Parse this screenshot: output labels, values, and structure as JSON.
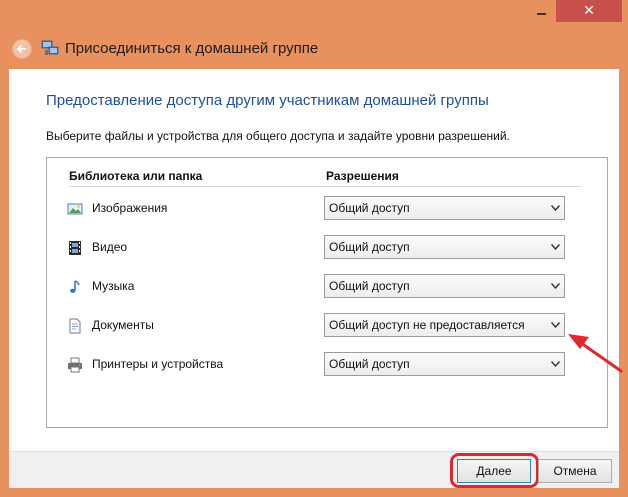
{
  "window": {
    "title": "Присоединиться к домашней группе",
    "close_glyph": "✕"
  },
  "content": {
    "heading": "Предоставление доступа другим участникам домашней группы",
    "instruction": "Выберите файлы и устройства для общего доступа и задайте уровни разрешений."
  },
  "table": {
    "col_library": "Библиотека или папка",
    "col_permissions": "Разрешения",
    "rows": [
      {
        "icon": "pictures-icon",
        "label": "Изображения",
        "permission": "Общий доступ"
      },
      {
        "icon": "video-icon",
        "label": "Видео",
        "permission": "Общий доступ"
      },
      {
        "icon": "music-icon",
        "label": "Музыка",
        "permission": "Общий доступ"
      },
      {
        "icon": "documents-icon",
        "label": "Документы",
        "permission": "Общий доступ не предоставляется"
      },
      {
        "icon": "printer-icon",
        "label": "Принтеры и устройства",
        "permission": "Общий доступ"
      }
    ]
  },
  "footer": {
    "next_label": "Далее",
    "cancel_label": "Отмена"
  },
  "colors": {
    "frame": "#e8915f",
    "heading": "#1e4f9c",
    "close_button": "#c7504a",
    "annotation": "#e0272d"
  }
}
